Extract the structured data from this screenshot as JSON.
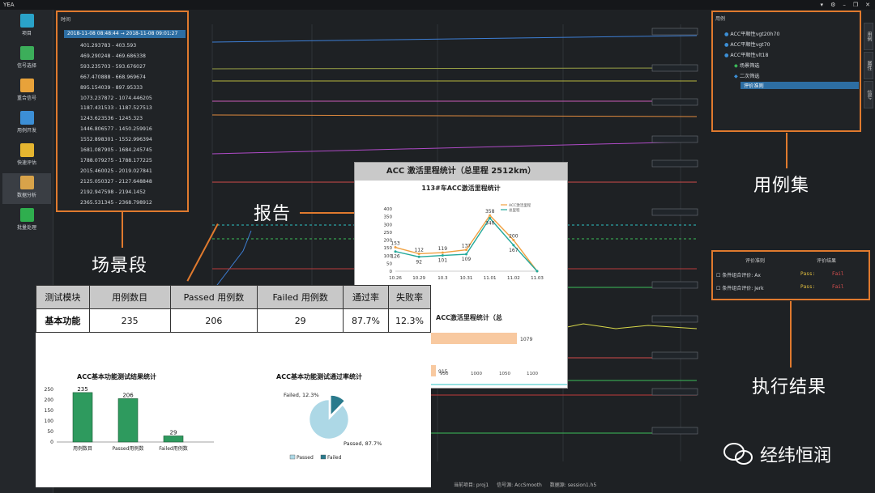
{
  "app": {
    "title": "YEA",
    "controls": [
      "shirt-icon",
      "gear-icon",
      "minimize",
      "restore",
      "close"
    ]
  },
  "nav": {
    "items": [
      {
        "label": "项目",
        "icon": "project-icon",
        "color": "#2aa3c9"
      },
      {
        "label": "信号选择",
        "icon": "signal-select-icon",
        "color": "#3cae5a"
      },
      {
        "label": "重合信号",
        "icon": "overlay-signal-icon",
        "color": "#e8a23a"
      },
      {
        "label": "用例开发",
        "icon": "case-dev-icon",
        "color": "#3c8fd6"
      },
      {
        "label": "快速评估",
        "icon": "quick-eval-icon",
        "color": "#e5b530"
      },
      {
        "label": "数据分析",
        "icon": "data-analysis-icon",
        "color": "#d8a34a"
      },
      {
        "label": "批量处理",
        "icon": "batch-icon",
        "color": "#2fae4e"
      }
    ],
    "active_index": 5
  },
  "scene": {
    "header": "时间",
    "selected": "2018-11-08 08:48:44 → 2018-11-08 09:01:27",
    "segments": [
      "401.293783 - 403.593",
      "469.290248 - 469.686338",
      "593.235703 - 593.676027",
      "667.470888 - 668.969674",
      "895.154039 - 897.95333",
      "1073.237872 - 1074.446205",
      "1187.431533 - 1187.527513",
      "1243.623536 - 1245.323",
      "1446.806577 - 1450.259916",
      "1552.898301 - 1552.996394",
      "1681.087905 - 1684.245745",
      "1788.079275 - 1788.177225",
      "2015.460025 - 2019.027841",
      "2125.050327 - 2127.648848",
      "2192.947598 - 2194.1452",
      "2365.531345 - 2368.798912"
    ]
  },
  "cases": {
    "header": "用例",
    "tree": [
      {
        "label": "ACC平顺性vgt20h70",
        "level": 0
      },
      {
        "label": "ACC平顺性vgt70",
        "level": 0
      },
      {
        "label": "ACC平顺性vlt18",
        "level": 0
      },
      {
        "label": "场景筛选",
        "level": 1
      },
      {
        "label": "二次筛选",
        "level": 1
      },
      {
        "label": "评价准则",
        "level": 1,
        "selected": true
      }
    ],
    "side_tabs": [
      "用例",
      "属性",
      "信号"
    ]
  },
  "results": {
    "col_criteria": "评价准则",
    "col_result": "评价结果",
    "rows": [
      {
        "label": "条件组合评价: Ax",
        "pass": "Pass:",
        "fail": "Fail"
      },
      {
        "label": "条件组合评价: Jerk",
        "pass": "Pass:",
        "fail": "Fail"
      }
    ]
  },
  "callouts": {
    "scene": "场景段",
    "report": "报告",
    "cases": "用例集",
    "results": "执行结果"
  },
  "mileage": {
    "header": "ACC 激活里程统计（总里程 2512km）",
    "line_title": "113#车ACC激活里程统计",
    "bar_title": "ACC激活里程统计（总",
    "bar_values": [
      "1079",
      "915"
    ],
    "bar_axis": [
      "950",
      "1000",
      "1050",
      "1100"
    ]
  },
  "report": {
    "headers": [
      "测试模块",
      "用例数目",
      "Passed 用例数",
      "Failed 用例数",
      "通过率",
      "失败率"
    ],
    "row": [
      "基本功能",
      "235",
      "206",
      "29",
      "87.7%",
      "12.3%"
    ],
    "colors": {
      "pass": "#22b14c",
      "fail": "#ff1a1a",
      "bar": "#2e9a5e",
      "pie": "#add8e6",
      "pie_fail": "#2a7a8c"
    }
  },
  "status_bar": {
    "project": "当前项目: proj1",
    "signal": "信号源: AccSmooth",
    "data": "数据源: session1.h5"
  },
  "watermark": {
    "text": "经纬恒润"
  },
  "chart_data": [
    {
      "type": "line",
      "title": "113#车ACC激活里程统计",
      "categories": [
        "10.26",
        "10.29",
        "10.3",
        "10.31",
        "11.01",
        "11.02",
        "11.03"
      ],
      "series": [
        {
          "name": "ACC激活里程",
          "values": [
            153,
            112,
            119,
            137,
            358,
            200,
            0
          ]
        },
        {
          "name": "总里程",
          "values": [
            126,
            92,
            101,
            109,
            340,
            167,
            0
          ]
        }
      ],
      "ylim": [
        0,
        400
      ],
      "yticks": [
        0,
        50,
        100,
        150,
        200,
        250,
        300,
        350,
        400
      ]
    },
    {
      "type": "bar",
      "title": "ACC基本功能测试结果统计",
      "categories": [
        "用例数目",
        "Passed用例数",
        "Failed用例数"
      ],
      "values": [
        235,
        206,
        29
      ],
      "ylim": [
        0,
        250
      ],
      "yticks": [
        0,
        50,
        100,
        150,
        200,
        250
      ]
    },
    {
      "type": "pie",
      "title": "ACC基本功能测试通过率统计",
      "labels": [
        "Passed",
        "Failed"
      ],
      "values": [
        87.7,
        12.3
      ],
      "slice_labels": [
        "Passed, 87.7%",
        "Failed, 12.3%"
      ]
    }
  ]
}
